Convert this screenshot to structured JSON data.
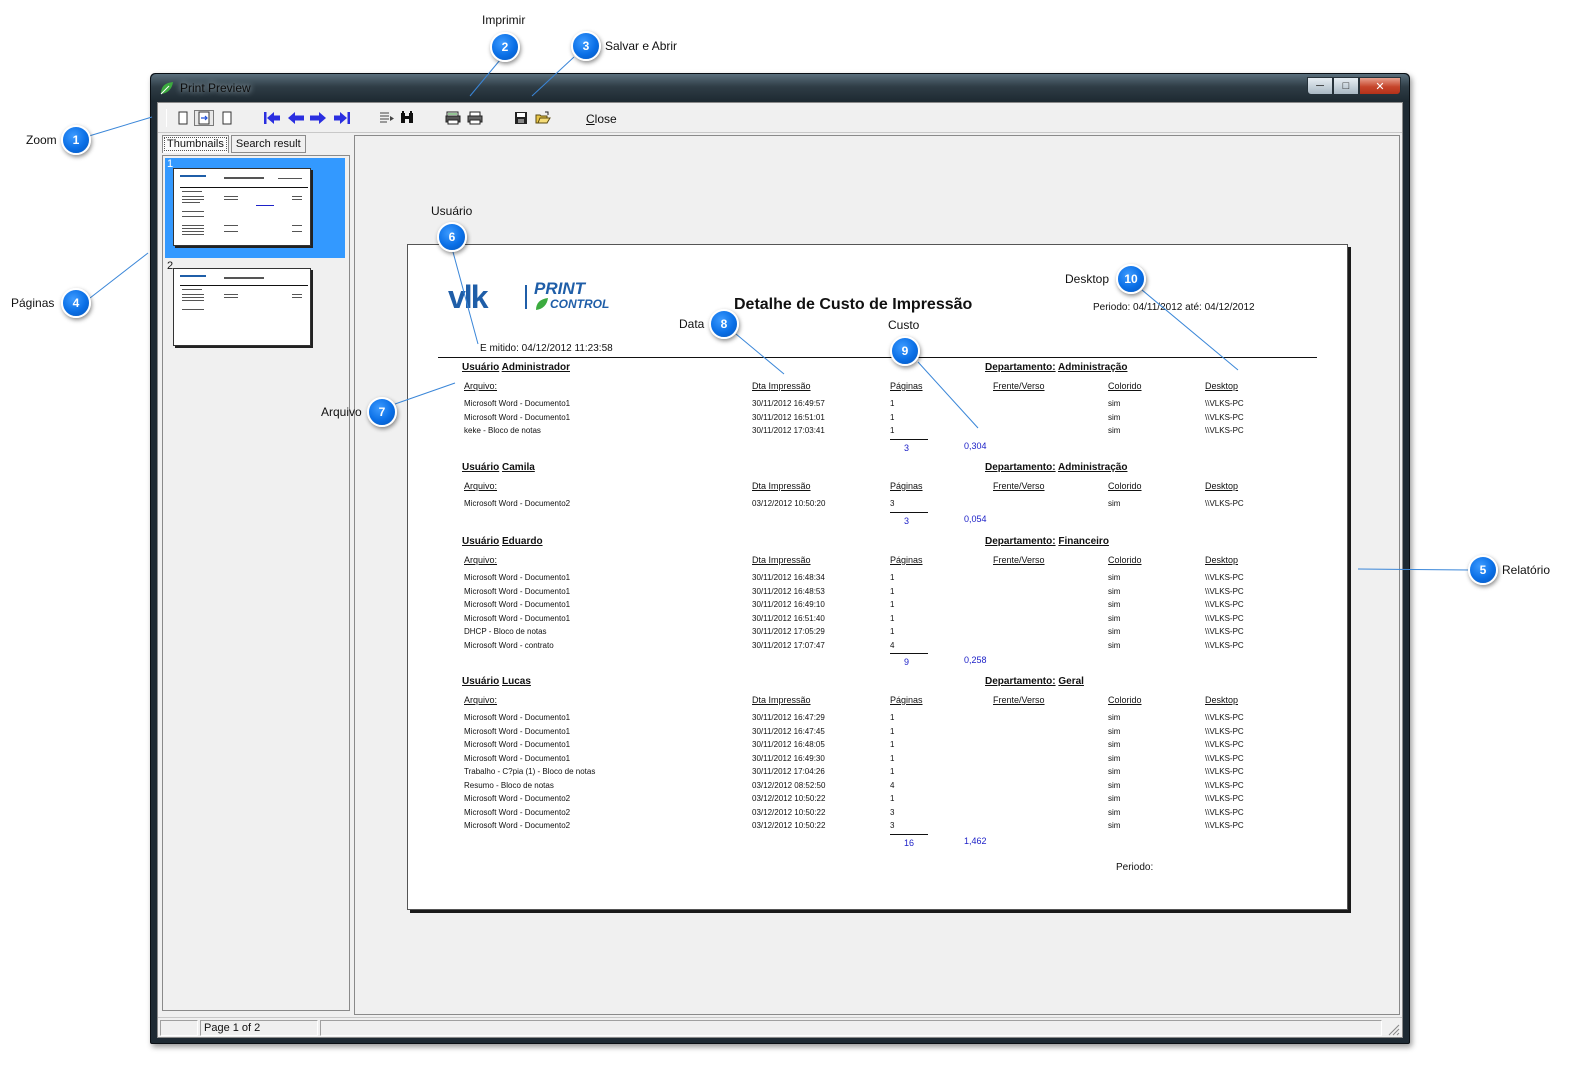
{
  "callouts": [
    {
      "n": "1",
      "label": "Zoom"
    },
    {
      "n": "2",
      "label": "Imprimir"
    },
    {
      "n": "3",
      "label": "Salvar e Abrir"
    },
    {
      "n": "4",
      "label": "Páginas"
    },
    {
      "n": "5",
      "label": "Relatório"
    },
    {
      "n": "6",
      "label": "Usuário"
    },
    {
      "n": "7",
      "label": "Arquivo"
    },
    {
      "n": "8",
      "label": "Data"
    },
    {
      "n": "9",
      "label": "Custo"
    },
    {
      "n": "10",
      "label": "Desktop"
    }
  ],
  "window": {
    "title": "Print Preview",
    "min_glyph": "─",
    "max_glyph": "□",
    "close_glyph": "✕"
  },
  "toolbar": {
    "close_first": "C",
    "close_rest": "lose",
    "icons": [
      "zoom-page-icon",
      "zoom-width-icon",
      "zoom-full-icon",
      "first-page-icon",
      "prev-page-icon",
      "next-page-icon",
      "last-page-icon",
      "page-setup-icon",
      "find-icon",
      "print-setup-icon",
      "print-icon",
      "save-icon",
      "open-icon"
    ]
  },
  "left_panel": {
    "tabs": [
      "Thumbnails",
      "Search result"
    ],
    "thumbnails": [
      {
        "num": "1"
      },
      {
        "num": "2"
      }
    ]
  },
  "status": {
    "page": "Page 1 of 2"
  },
  "colors": {
    "accent": "#3399ff",
    "callout": "#0a6fe6",
    "totals": "#1e22c8",
    "logo_blue": "#1f5ea8",
    "logo_green": "#3cab3f"
  },
  "report": {
    "logo_vlk": "vlk",
    "logo_print": "PRINT",
    "logo_control": "CONTROL",
    "title": "Detalhe de Custo de Impressão",
    "periodo": "Periodo: 04/11/2012  até: 04/12/2012",
    "emitido": "E mitido: 04/12/2012 11:23:58",
    "col_headers": {
      "arquivo": "Arquivo:",
      "data": "Dta Impressão",
      "paginas": "Páginas",
      "frente": "Frente/Verso",
      "colorido": "Colorido",
      "desktop": "Desktop"
    },
    "usuario_label": "Usuário",
    "departamento_label": "Departamento:",
    "footer": "Periodo:",
    "groups": [
      {
        "user": "Administrador",
        "dept": "Administração",
        "rows": [
          {
            "file": "Microsoft Word - Documento1",
            "date": "30/11/2012 16:49:57",
            "pages": "1",
            "color": "sim",
            "desktop": "\\\\VLKS-PC"
          },
          {
            "file": "Microsoft Word - Documento1",
            "date": "30/11/2012 16:51:01",
            "pages": "1",
            "color": "sim",
            "desktop": "\\\\VLKS-PC"
          },
          {
            "file": "keke - Bloco de notas",
            "date": "30/11/2012 17:03:41",
            "pages": "1",
            "color": "sim",
            "desktop": "\\\\VLKS-PC"
          }
        ],
        "total_pages": "3",
        "total_cost": "0,304"
      },
      {
        "user": "Camila",
        "dept": "Administração",
        "rows": [
          {
            "file": "Microsoft Word - Documento2",
            "date": "03/12/2012 10:50:20",
            "pages": "3",
            "color": "sim",
            "desktop": "\\\\VLKS-PC"
          }
        ],
        "total_pages": "3",
        "total_cost": "0,054"
      },
      {
        "user": "Eduardo",
        "dept": "Financeiro",
        "rows": [
          {
            "file": "Microsoft Word - Documento1",
            "date": "30/11/2012 16:48:34",
            "pages": "1",
            "color": "sim",
            "desktop": "\\\\VLKS-PC"
          },
          {
            "file": "Microsoft Word - Documento1",
            "date": "30/11/2012 16:48:53",
            "pages": "1",
            "color": "sim",
            "desktop": "\\\\VLKS-PC"
          },
          {
            "file": "Microsoft Word - Documento1",
            "date": "30/11/2012 16:49:10",
            "pages": "1",
            "color": "sim",
            "desktop": "\\\\VLKS-PC"
          },
          {
            "file": "Microsoft Word - Documento1",
            "date": "30/11/2012 16:51:40",
            "pages": "1",
            "color": "sim",
            "desktop": "\\\\VLKS-PC"
          },
          {
            "file": "DHCP - Bloco de notas",
            "date": "30/11/2012 17:05:29",
            "pages": "1",
            "color": "sim",
            "desktop": "\\\\VLKS-PC"
          },
          {
            "file": "Microsoft Word - contrato",
            "date": "30/11/2012 17:07:47",
            "pages": "4",
            "color": "sim",
            "desktop": "\\\\VLKS-PC"
          }
        ],
        "total_pages": "9",
        "total_cost": "0,258"
      },
      {
        "user": "Lucas",
        "dept": "Geral",
        "rows": [
          {
            "file": "Microsoft Word - Documento1",
            "date": "30/11/2012 16:47:29",
            "pages": "1",
            "color": "sim",
            "desktop": "\\\\VLKS-PC"
          },
          {
            "file": "Microsoft Word - Documento1",
            "date": "30/11/2012 16:47:45",
            "pages": "1",
            "color": "sim",
            "desktop": "\\\\VLKS-PC"
          },
          {
            "file": "Microsoft Word - Documento1",
            "date": "30/11/2012 16:48:05",
            "pages": "1",
            "color": "sim",
            "desktop": "\\\\VLKS-PC"
          },
          {
            "file": "Microsoft Word - Documento1",
            "date": "30/11/2012 16:49:30",
            "pages": "1",
            "color": "sim",
            "desktop": "\\\\VLKS-PC"
          },
          {
            "file": "Trabalho - C?pia (1) - Bloco de notas",
            "date": "30/11/2012 17:04:26",
            "pages": "1",
            "color": "sim",
            "desktop": "\\\\VLKS-PC"
          },
          {
            "file": "Resumo - Bloco de notas",
            "date": "03/12/2012 08:52:50",
            "pages": "4",
            "color": "sim",
            "desktop": "\\\\VLKS-PC"
          },
          {
            "file": "Microsoft Word - Documento2",
            "date": "03/12/2012 10:50:22",
            "pages": "1",
            "color": "sim",
            "desktop": "\\\\VLKS-PC"
          },
          {
            "file": "Microsoft Word - Documento2",
            "date": "03/12/2012 10:50:22",
            "pages": "3",
            "color": "sim",
            "desktop": "\\\\VLKS-PC"
          },
          {
            "file": "Microsoft Word - Documento2",
            "date": "03/12/2012 10:50:22",
            "pages": "3",
            "color": "sim",
            "desktop": "\\\\VLKS-PC"
          }
        ],
        "total_pages": "16",
        "total_cost": "1,462"
      }
    ]
  }
}
